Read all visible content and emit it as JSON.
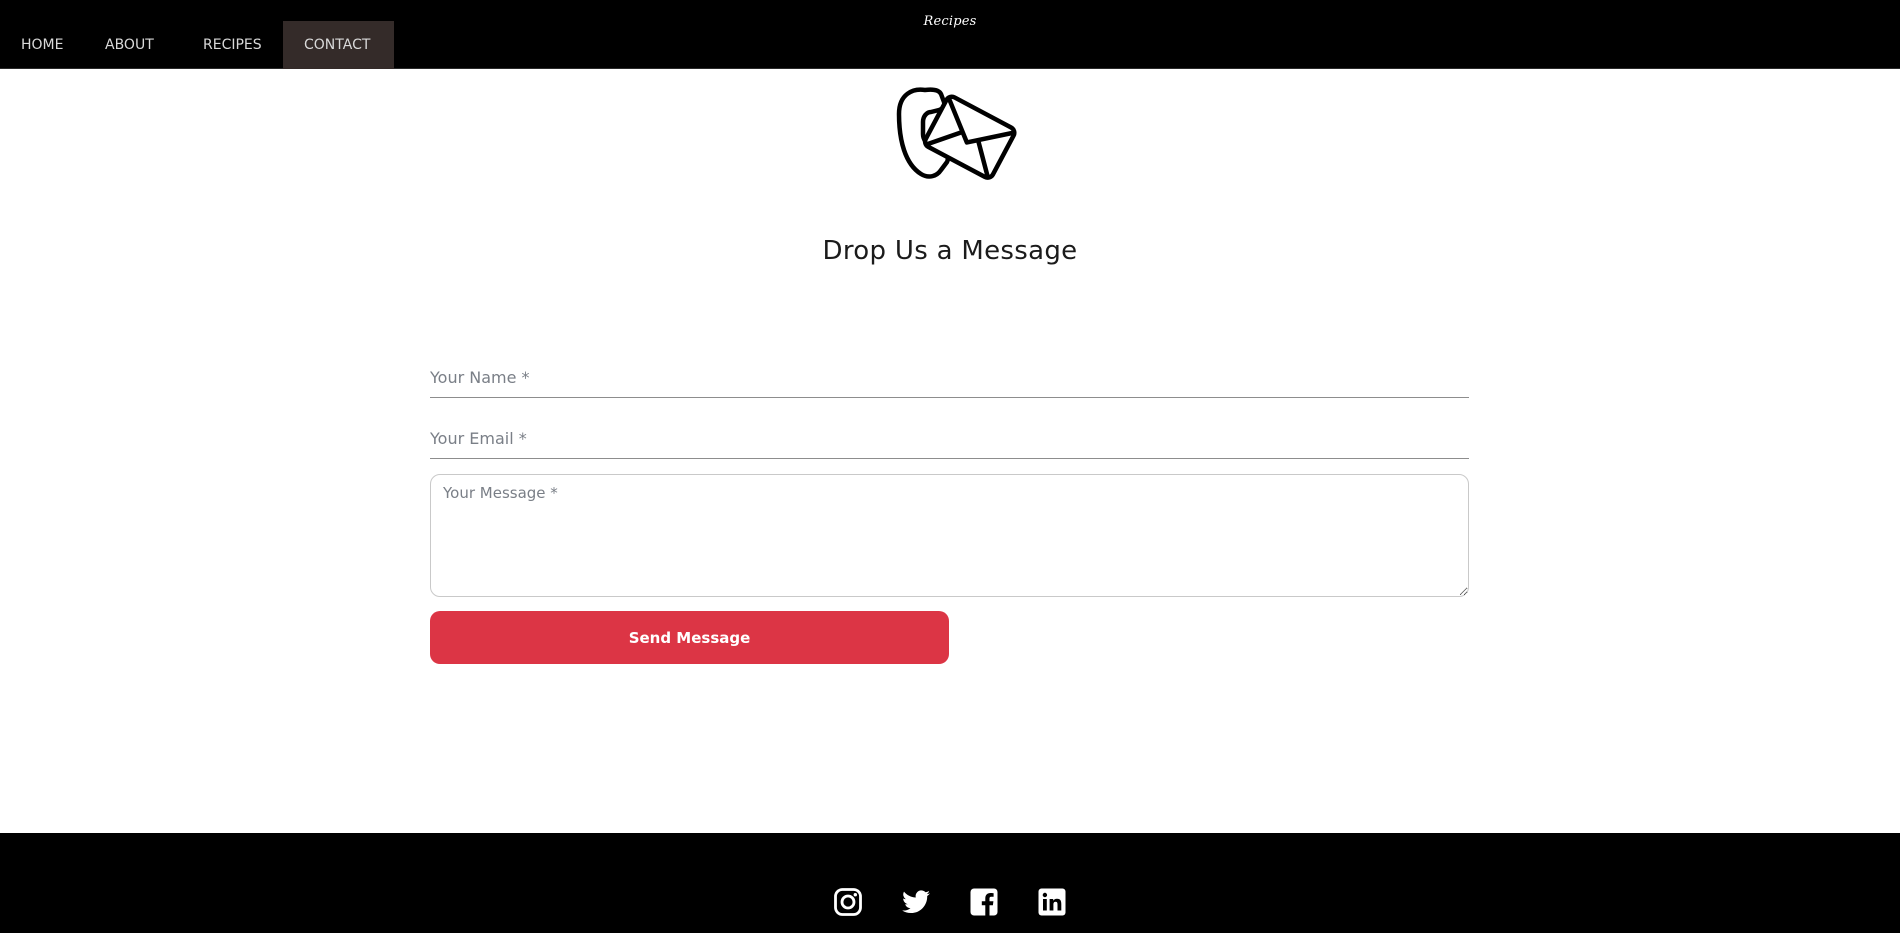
{
  "brand": {
    "name": "Recipes"
  },
  "nav": {
    "items": [
      {
        "label": "HOME"
      },
      {
        "label": "ABOUT"
      },
      {
        "label": "RECIPES"
      },
      {
        "label": "CONTACT",
        "active": true
      }
    ]
  },
  "hero": {
    "icon": "phone-envelope-icon",
    "title": "Drop Us a Message"
  },
  "form": {
    "name_placeholder": "Your Name *",
    "email_placeholder": "Your Email *",
    "message_placeholder": "Your Message *",
    "submit_label": "Send Message"
  },
  "footer": {
    "social": [
      {
        "icon": "instagram-icon"
      },
      {
        "icon": "twitter-icon"
      },
      {
        "icon": "facebook-icon"
      },
      {
        "icon": "linkedin-icon"
      }
    ]
  },
  "colors": {
    "nav_background": "#000000",
    "nav_active": "#342b29",
    "accent": "#dc3545",
    "footer_background": "#000000"
  }
}
